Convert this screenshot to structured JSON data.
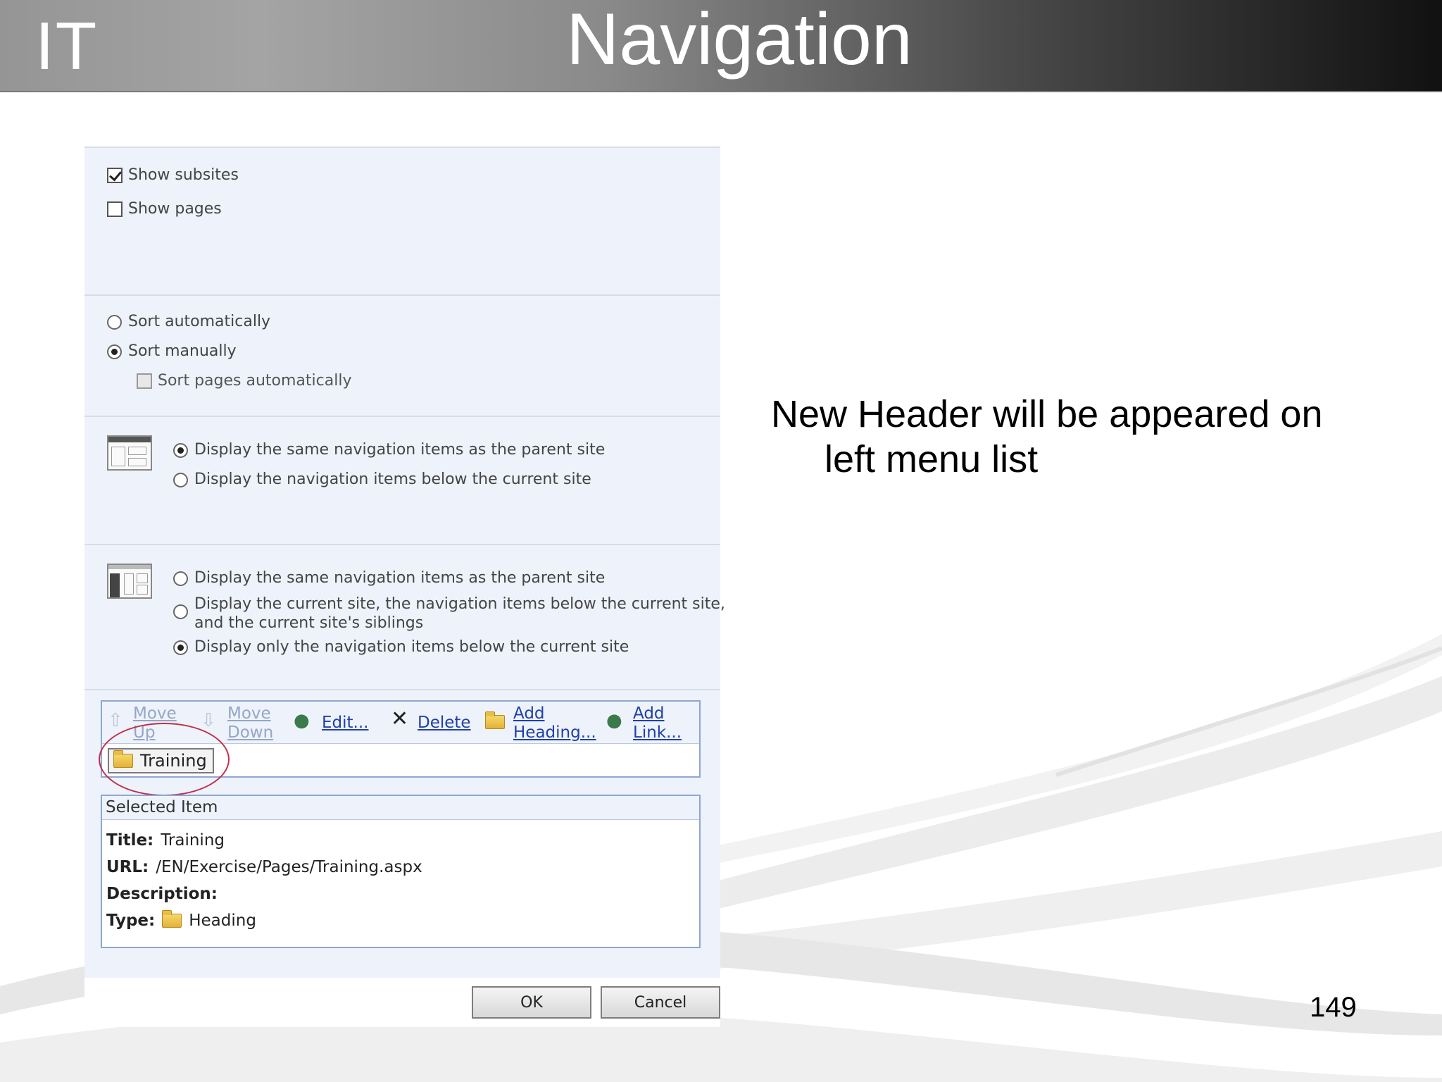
{
  "slide": {
    "logo": "IT",
    "title": "Navigation",
    "note_line1": "New Header will be appeared on",
    "note_line2": "left menu list",
    "page_number": "149"
  },
  "subsites": {
    "show_subsites": {
      "label": "Show subsites",
      "checked": true
    },
    "show_pages": {
      "label": "Show pages",
      "checked": false
    }
  },
  "sorting": {
    "sort_automatically": "Sort automatically",
    "sort_manually": "Sort manually",
    "sort_pages_automatically": "Sort pages automatically",
    "selected": "sort_manually"
  },
  "global_nav": {
    "icon": "global-navigation-icon",
    "option1": "Display the same navigation items as the parent site",
    "option2": "Display the navigation items below the current site",
    "selected": "option1"
  },
  "current_nav": {
    "icon": "current-navigation-icon",
    "option1": "Display the same navigation items as the parent site",
    "option2_line1": "Display the current site, the navigation items below the current site,",
    "option2_line2": "and the current site's siblings",
    "option3": "Display only the navigation items below the current site",
    "selected": "option3"
  },
  "toolbar": {
    "move_up_1": "Move",
    "move_up_2": "Up",
    "move_down_1": "Move",
    "move_down_2": "Down",
    "edit": "Edit...",
    "delete": "Delete",
    "add_heading_1": "Add",
    "add_heading_2": "Heading...",
    "add_link_1": "Add",
    "add_link_2": "Link..."
  },
  "tree": {
    "item": "Training"
  },
  "selected_item": {
    "header": "Selected Item",
    "title_label": "Title:",
    "title_value": "Training",
    "url_label": "URL:",
    "url_value": "/EN/Exercise/Pages/Training.aspx",
    "description_label": "Description:",
    "type_label": "Type:",
    "type_value": "Heading"
  },
  "buttons": {
    "ok": "OK",
    "cancel": "Cancel"
  },
  "colors": {
    "link": "#1f3fa8",
    "section_bg": "#edf2fb",
    "highlight_circle": "#c0304a"
  }
}
